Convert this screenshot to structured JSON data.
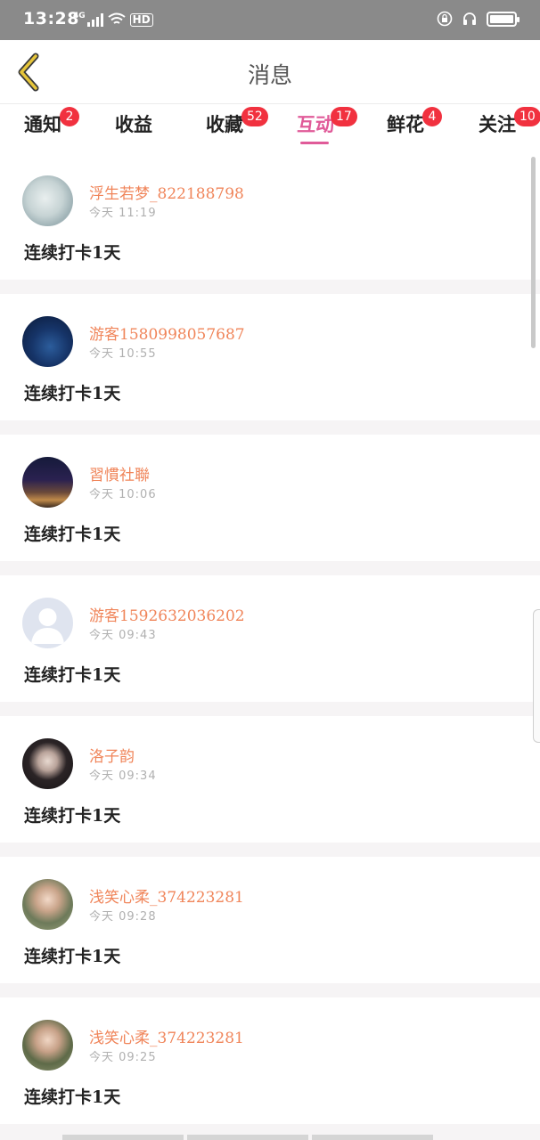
{
  "status_bar": {
    "time": "13:28",
    "network": "4G",
    "hd": "HD"
  },
  "header": {
    "title": "消息",
    "back_icon": "chevron-left-icon"
  },
  "tabs": [
    {
      "label": "通知",
      "badge": "2",
      "active": false
    },
    {
      "label": "收益",
      "badge": "",
      "active": false
    },
    {
      "label": "收藏",
      "badge": "52",
      "active": false
    },
    {
      "label": "互动",
      "badge": "17",
      "active": true
    },
    {
      "label": "鲜花",
      "badge": "4",
      "active": false
    },
    {
      "label": "关注",
      "badge": "10",
      "active": false
    }
  ],
  "messages": [
    {
      "username": "浮生若梦_822188798",
      "time": "今天 11:19",
      "content": "连续打卡1天"
    },
    {
      "username": "游客1580998057687",
      "time": "今天 10:55",
      "content": "连续打卡1天"
    },
    {
      "username": "習慣社聯",
      "time": "今天 10:06",
      "content": "连续打卡1天"
    },
    {
      "username": "游客1592632036202",
      "time": "今天 09:43",
      "content": "连续打卡1天"
    },
    {
      "username": "洛子韵",
      "time": "今天 09:34",
      "content": "连续打卡1天"
    },
    {
      "username": "浅笑心柔_374223281",
      "time": "今天 09:28",
      "content": "连续打卡1天"
    },
    {
      "username": "浅笑心柔_374223281",
      "time": "今天 09:25",
      "content": "连续打卡1天"
    }
  ],
  "colors": {
    "accent": "#e05b99",
    "username": "#f0855a",
    "badge": "#f1313f",
    "back_icon": "#e6c53a"
  }
}
